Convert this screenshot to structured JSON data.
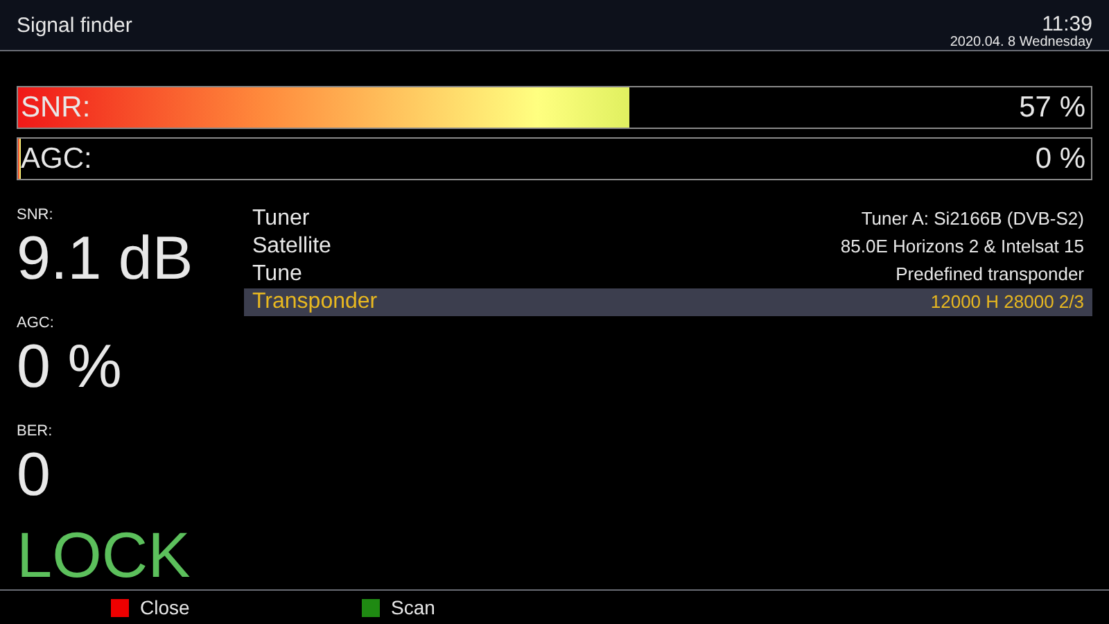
{
  "window": {
    "title": "Signal finder",
    "time": "11:39",
    "date": "2020.04. 8 Wednesday"
  },
  "bars": [
    {
      "label": "SNR:",
      "level": 0.57,
      "reading": "57 %"
    },
    {
      "label": "AGC:",
      "level": 0,
      "reading": "0 %"
    }
  ],
  "stats": [
    {
      "label": "SNR:",
      "value": "9.1 dB"
    },
    {
      "label": "AGC:",
      "value": "0 %"
    },
    {
      "label": "BER:",
      "value": "0"
    }
  ],
  "lock_status": "LOCK",
  "rows": [
    {
      "name": "Tuner",
      "value": "Tuner A: Si2166B (DVB-S2)",
      "selected": false
    },
    {
      "name": "Satellite",
      "value": "85.0E Horizons 2 & Intelsat 15",
      "selected": false
    },
    {
      "name": "Tune",
      "value": "Predefined transponder",
      "selected": false
    },
    {
      "name": "Transponder",
      "value": "12000 H 28000 2/3",
      "selected": true
    }
  ],
  "buttons": [
    {
      "label": "Close",
      "color": "#ee0000"
    },
    {
      "label": "Scan",
      "color": "#1f8a12"
    }
  ]
}
